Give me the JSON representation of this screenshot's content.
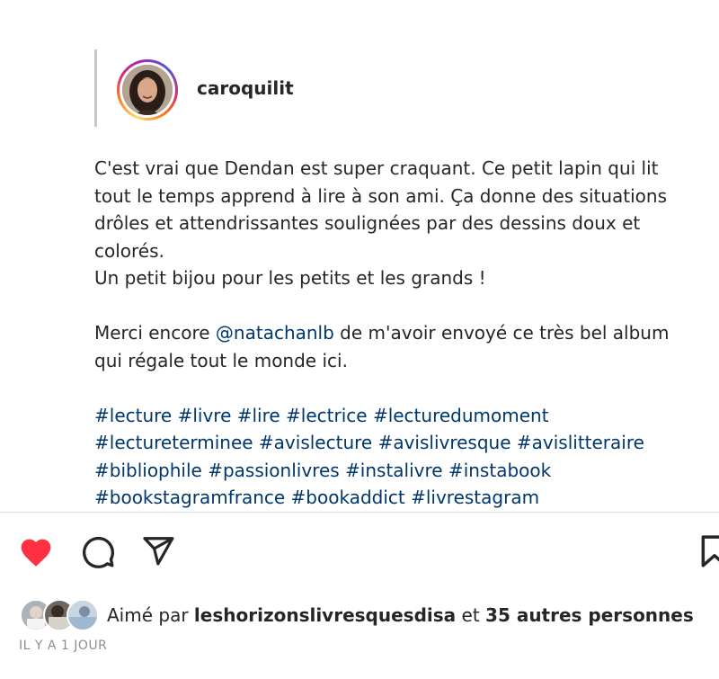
{
  "post": {
    "username": "caroquilit",
    "caption": {
      "paragraph1": [
        "C'est vrai que Dendan est super craquant. Ce petit lapin qui lit",
        "tout le temps apprend à lire à son ami. Ça donne des situations",
        "drôles et attendrissantes soulignées par des dessins doux et",
        "colorés.",
        "Un petit bijou pour les petits et les grands !"
      ],
      "paragraph2": {
        "before": "Merci encore ",
        "mention": "@natachanlb",
        "after_line1": " de m'avoir envoyé ce très bel album",
        "line2": "qui régale tout le monde ici."
      },
      "hashtag_lines": [
        "#lecture #livre #lire #lectrice #lecturedumoment",
        "#lectureterminee #avislecture #avislivresque #avislitteraire",
        "#bibliophile #passionlivres #instalivre #instabook",
        "#bookstagramfrance #bookaddict #livrestagram"
      ]
    }
  },
  "actions": {
    "like_icon": "heart-filled-icon",
    "comment_icon": "comment-bubble-icon",
    "share_icon": "paper-plane-icon",
    "save_icon": "bookmark-icon",
    "liked_color": "#ff3040"
  },
  "likes": {
    "prefix": "Aimé par ",
    "first_liker": "leshorizonslivresquesdisa",
    "connector": " et ",
    "others": "35 autres personnes"
  },
  "timestamp": "IL Y A 1 JOUR"
}
